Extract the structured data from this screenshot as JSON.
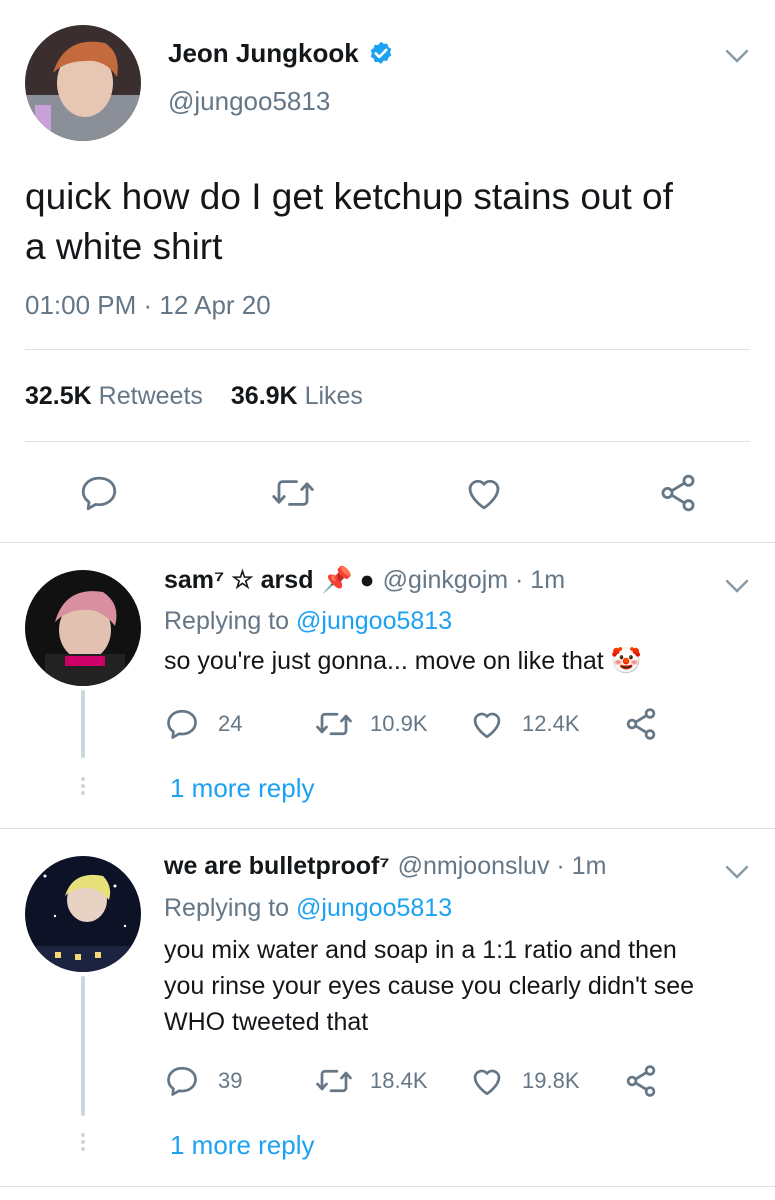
{
  "tweet": {
    "display_name": "Jeon Jungkook",
    "handle": "@jungoo5813",
    "text_line1": "quick how do I get ketchup stains out of",
    "text_line2": "a white shirt",
    "timestamp": "01:00 PM · 12 Apr 20",
    "retweets_count": "32.5K",
    "retweets_label": "Retweets",
    "likes_count": "36.9K",
    "likes_label": "Likes",
    "verified": true
  },
  "replies": [
    {
      "display_name": "sam⁷ ☆ arsd",
      "extra_emoji": "📌 ●",
      "handle_time": "@ginkgojm · 1m",
      "replying_prefix": "Replying to",
      "replying_handle": "@jungoo5813",
      "text": "so you're just gonna... move on like that 🤡",
      "reply_count": "24",
      "retweet_count": "10.9K",
      "like_count": "12.4K",
      "more_replies": "1 more reply"
    },
    {
      "display_name": "we are bulletproof⁷",
      "handle_time": "@nmjoonsluv · 1m",
      "replying_prefix": "Replying to",
      "replying_handle": "@jungoo5813",
      "text_line1": "you mix water and soap in a 1:1 ratio and then",
      "text_line2": "you rinse your eyes cause you clearly didn't see",
      "text_line3": "WHO tweeted that",
      "reply_count": "39",
      "retweet_count": "18.4K",
      "like_count": "19.8K",
      "more_replies": "1 more reply"
    }
  ],
  "colors": {
    "accent": "#1da1f2",
    "secondary_text": "#657786",
    "divider": "#dbe1e6"
  },
  "icons": [
    "chevron-down-icon",
    "verified-badge-icon",
    "reply-icon",
    "retweet-icon",
    "like-icon",
    "share-icon"
  ]
}
